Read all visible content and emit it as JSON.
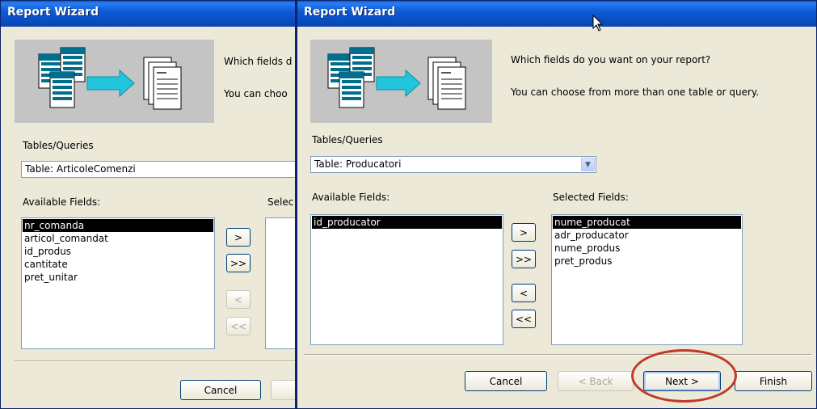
{
  "back_window": {
    "title": "Report Wizard",
    "prompt_line1": "Which fields d",
    "prompt_line2": "You can choo",
    "tables_label": "Tables/Queries",
    "table_value": "Table: ArticoleComenzi",
    "available_label": "Available Fields:",
    "selected_label": "Selec",
    "available_fields": [
      "nr_comanda",
      "articol_comandat",
      "id_produs",
      "cantitate",
      "pret_unitar"
    ],
    "move_buttons": [
      ">",
      ">>",
      "<",
      "<<"
    ],
    "cancel_label": "Cancel"
  },
  "front_window": {
    "title": "Report Wizard",
    "prompt_line1": "Which fields do you want on your report?",
    "prompt_line2": "You can choose from more than one table or query.",
    "tables_label": "Tables/Queries",
    "table_value": "Table: Producatori",
    "available_label": "Available Fields:",
    "selected_label": "Selected Fields:",
    "available_fields": [
      "id_producator"
    ],
    "selected_fields": [
      "nume_producat",
      "adr_producator",
      "nume_produs",
      "pret_produs"
    ],
    "move_buttons": [
      ">",
      ">>",
      "<",
      "<<"
    ],
    "buttons": {
      "cancel": "Cancel",
      "back": "< Back",
      "next": "Next >",
      "finish": "Finish"
    }
  },
  "icons": [
    "wizard-illustration-icon",
    "combo-dropdown-icon",
    "mouse-pointer-icon"
  ],
  "colors": {
    "titlebar": "#0a5fd8",
    "dialog": "#ece9d8",
    "highlight_oval": "#c0392b"
  }
}
